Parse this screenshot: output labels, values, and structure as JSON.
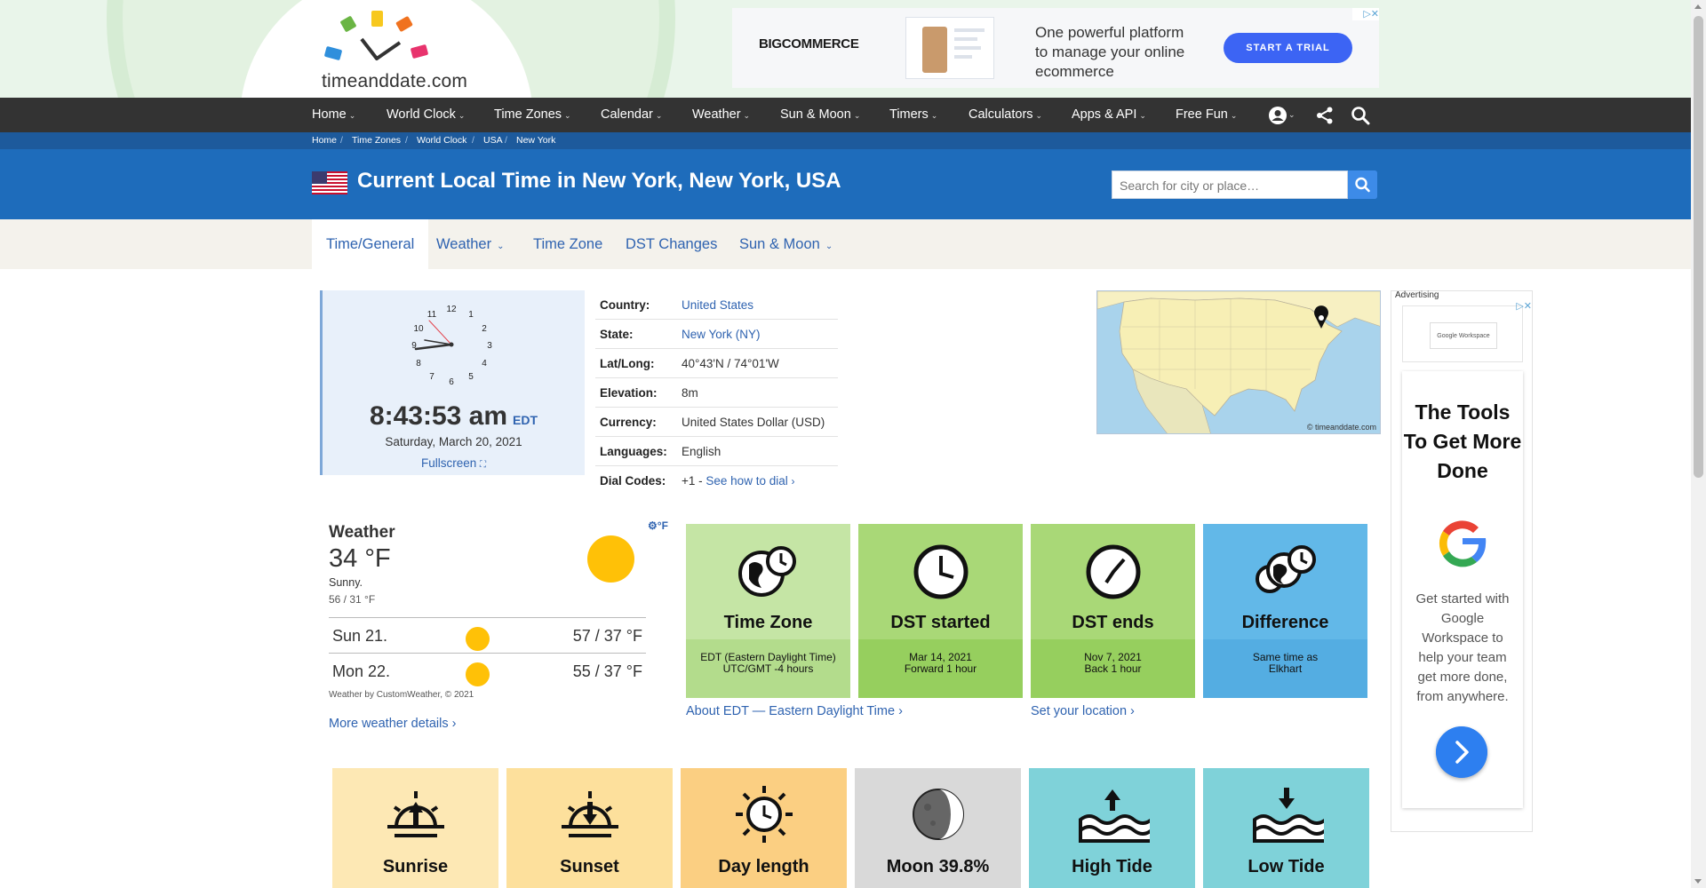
{
  "header": {
    "logo_text": "timeanddate.com",
    "ad": {
      "brand": "BIGCOMMERCE",
      "copy": "One powerful platform to manage your online ecommerce",
      "cta": "START A TRIAL"
    }
  },
  "nav": {
    "items": [
      {
        "label": "Home"
      },
      {
        "label": "World Clock"
      },
      {
        "label": "Time Zones"
      },
      {
        "label": "Calendar"
      },
      {
        "label": "Weather"
      },
      {
        "label": "Sun & Moon"
      },
      {
        "label": "Timers"
      },
      {
        "label": "Calculators"
      },
      {
        "label": "Apps & API"
      },
      {
        "label": "Free Fun"
      }
    ],
    "icons": [
      "user-icon",
      "share-icon",
      "search-icon"
    ]
  },
  "breadcrumb": [
    "Home",
    "Time Zones",
    "World Clock",
    "USA",
    "New York"
  ],
  "title": {
    "text": "Current Local Time in New York, New York, USA",
    "search_placeholder": "Search for city or place…"
  },
  "subnav": {
    "tabs": [
      {
        "label": "Time/General",
        "active": true
      },
      {
        "label": "Weather",
        "dropdown": true
      },
      {
        "label": "Time Zone"
      },
      {
        "label": "DST Changes"
      },
      {
        "label": "Sun & Moon",
        "dropdown": true
      }
    ]
  },
  "clock": {
    "time": "8:43:53 am",
    "tz": "EDT",
    "date": "Saturday, March 20, 2021",
    "fullscreen": "Fullscreen"
  },
  "info": {
    "rows": [
      {
        "label": "Country:",
        "value": "United States",
        "link": true
      },
      {
        "label": "State:",
        "value": "New York (NY)",
        "link": true
      },
      {
        "label": "Lat/Long:",
        "value": "40°43'N / 74°01'W"
      },
      {
        "label": "Elevation:",
        "value": "8m"
      },
      {
        "label": "Currency:",
        "value": "United States Dollar (USD)"
      },
      {
        "label": "Languages:",
        "value": "English"
      },
      {
        "label": "Dial Codes:",
        "value": "+1 -",
        "link_text": "See how to dial"
      }
    ]
  },
  "map": {
    "copyright": "© timeanddate.com"
  },
  "weather": {
    "unit_toggle": "°F",
    "title": "Weather",
    "temp": "34 °F",
    "condition": "Sunny.",
    "hilo": "56 / 31 °F",
    "forecast": [
      {
        "day": "Sun 21.",
        "temps": "57 / 37 °F"
      },
      {
        "day": "Mon 22.",
        "temps": "55 / 37 °F"
      }
    ],
    "credit": "Weather by CustomWeather, © 2021",
    "more": "More weather details"
  },
  "tiles": [
    {
      "title": "Time Zone",
      "sub1": "EDT (Eastern Daylight Time)",
      "sub2": "UTC/GMT -4 hours",
      "color_top": "#c5e5a5",
      "color_bottom": "#b3dc8c"
    },
    {
      "title": "DST started",
      "sub1": "Mar 14, 2021",
      "sub2": "Forward 1 hour",
      "color_top": "#a9d877",
      "color_bottom": "#96cf5e"
    },
    {
      "title": "DST ends",
      "sub1": "Nov 7, 2021",
      "sub2": "Back 1 hour",
      "color_top": "#a9d877",
      "color_bottom": "#96cf5e"
    },
    {
      "title": "Difference",
      "sub1": "Same time as",
      "sub2": "Elkhart",
      "color_top": "#62b8e8",
      "color_bottom": "#54ade2"
    }
  ],
  "tile_links": {
    "about_edt": "About EDT — Eastern Daylight Time",
    "set_location": "Set your location"
  },
  "bottom_tiles": [
    {
      "title": "Sunrise",
      "color": "#fde8b4"
    },
    {
      "title": "Sunset",
      "color": "#fde09c"
    },
    {
      "title": "Day length",
      "color": "#fbcf82"
    },
    {
      "title": "Moon 39.8%",
      "color": "#d9d9d9"
    },
    {
      "title": "High Tide",
      "color": "#7fd2d9"
    },
    {
      "title": "Low Tide",
      "color": "#7fd2d9"
    }
  ],
  "right_ad": {
    "label": "Advertising",
    "thumb_text": "Google Workspace",
    "headline": "The Tools To Get More Done",
    "body": "Get started with Google Workspace to help your team get more done, from anywhere."
  }
}
